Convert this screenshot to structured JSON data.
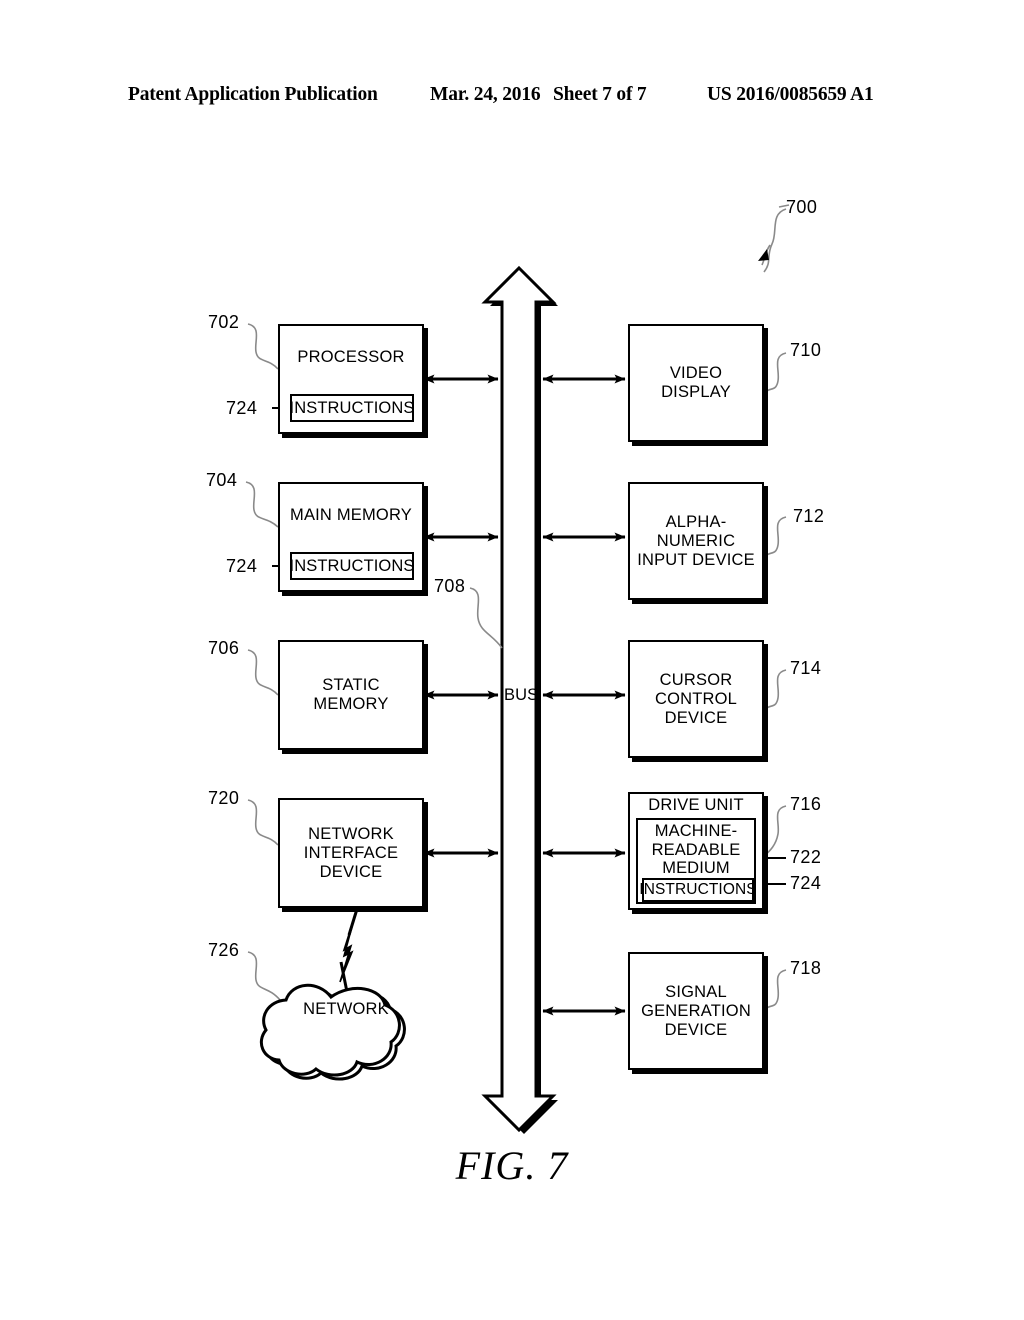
{
  "header": {
    "publication": "Patent Application Publication",
    "date": "Mar. 24, 2016",
    "sheet": "Sheet 7 of 7",
    "number": "US 2016/0085659 A1"
  },
  "figure": {
    "caption": "FIG. 7",
    "system_ref": "700",
    "bus_label": "BUS",
    "bus_ref": "708"
  },
  "blocks": {
    "processor": {
      "label": "PROCESSOR",
      "ref": "702",
      "inner_label": "INSTRUCTIONS",
      "inner_ref": "724"
    },
    "main_memory": {
      "label": "MAIN MEMORY",
      "ref": "704",
      "inner_label": "INSTRUCTIONS",
      "inner_ref": "724"
    },
    "static_memory": {
      "label": "STATIC\nMEMORY",
      "ref": "706"
    },
    "network_interface": {
      "label": "NETWORK\nINTERFACE\nDEVICE",
      "ref": "720"
    },
    "network_cloud": {
      "label": "NETWORK",
      "ref": "726"
    },
    "video_display": {
      "label": "VIDEO\nDISPLAY",
      "ref": "710"
    },
    "alpha_numeric_input": {
      "label": "ALPHA-NUMERIC\nINPUT DEVICE",
      "ref": "712"
    },
    "cursor_control": {
      "label": "CURSOR\nCONTROL\nDEVICE",
      "ref": "714"
    },
    "drive_unit": {
      "label": "DRIVE UNIT",
      "ref": "716",
      "medium_label": "MACHINE-\nREADABLE\nMEDIUM",
      "medium_ref": "722",
      "instructions_label": "INSTRUCTIONS",
      "instructions_ref": "724"
    },
    "signal_generation": {
      "label": "SIGNAL\nGENERATION\nDEVICE",
      "ref": "718"
    }
  },
  "colors": {
    "ink": "#000000",
    "paper": "#ffffff",
    "leader": "#8a8a8a"
  }
}
